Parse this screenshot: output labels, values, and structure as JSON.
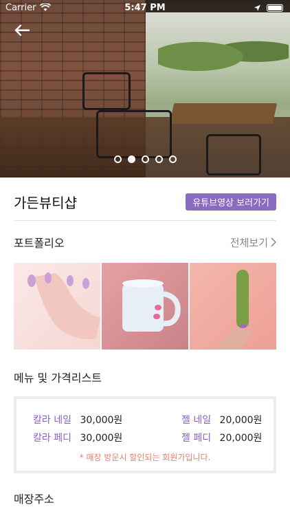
{
  "status": {
    "carrier": "Carrier",
    "time": "5:47 PM"
  },
  "hero": {
    "slides": 5,
    "active_index": 1
  },
  "shop": {
    "name": "가든뷰티샵",
    "youtube_button": "유튜브영상 보러가기"
  },
  "portfolio": {
    "title": "포트폴리오",
    "see_all": "전체보기"
  },
  "menu": {
    "title": "메뉴 및 가격리스트",
    "items": [
      {
        "name": "칼라 네일",
        "price": "30,000원"
      },
      {
        "name": "젤 네일",
        "price": "20,000원"
      },
      {
        "name": "칼라 페디",
        "price": "30,000원"
      },
      {
        "name": "젤 페디",
        "price": "20,000원"
      }
    ],
    "notice": "* 매장 방문시 할인되는 회원가입니다."
  },
  "address": {
    "title": "매장주소"
  },
  "colors": {
    "accent": "#8b6bbf",
    "notice": "#e57f6f"
  }
}
